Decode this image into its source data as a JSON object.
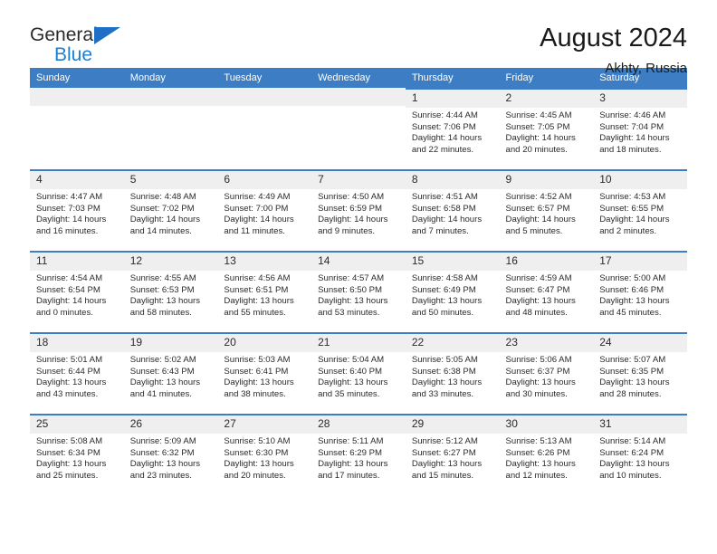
{
  "brand": {
    "name_part1": "General",
    "name_part2": "Blue",
    "accent_color": "#1f6fc4",
    "logo_icon": "triangle-icon"
  },
  "header": {
    "title": "August 2024",
    "location": "Akhty, Russia"
  },
  "calendar": {
    "header_bg": "#3c7dc4",
    "cell_accent": "#3c7dc4",
    "daynum_bg": "#efefef",
    "weekdays": [
      "Sunday",
      "Monday",
      "Tuesday",
      "Wednesday",
      "Thursday",
      "Friday",
      "Saturday"
    ],
    "weeks": [
      [
        {
          "day": "",
          "empty": true
        },
        {
          "day": "",
          "empty": true
        },
        {
          "day": "",
          "empty": true
        },
        {
          "day": "",
          "empty": true
        },
        {
          "day": "1",
          "sunrise": "Sunrise: 4:44 AM",
          "sunset": "Sunset: 7:06 PM",
          "daylight1": "Daylight: 14 hours",
          "daylight2": "and 22 minutes."
        },
        {
          "day": "2",
          "sunrise": "Sunrise: 4:45 AM",
          "sunset": "Sunset: 7:05 PM",
          "daylight1": "Daylight: 14 hours",
          "daylight2": "and 20 minutes."
        },
        {
          "day": "3",
          "sunrise": "Sunrise: 4:46 AM",
          "sunset": "Sunset: 7:04 PM",
          "daylight1": "Daylight: 14 hours",
          "daylight2": "and 18 minutes."
        }
      ],
      [
        {
          "day": "4",
          "sunrise": "Sunrise: 4:47 AM",
          "sunset": "Sunset: 7:03 PM",
          "daylight1": "Daylight: 14 hours",
          "daylight2": "and 16 minutes."
        },
        {
          "day": "5",
          "sunrise": "Sunrise: 4:48 AM",
          "sunset": "Sunset: 7:02 PM",
          "daylight1": "Daylight: 14 hours",
          "daylight2": "and 14 minutes."
        },
        {
          "day": "6",
          "sunrise": "Sunrise: 4:49 AM",
          "sunset": "Sunset: 7:00 PM",
          "daylight1": "Daylight: 14 hours",
          "daylight2": "and 11 minutes."
        },
        {
          "day": "7",
          "sunrise": "Sunrise: 4:50 AM",
          "sunset": "Sunset: 6:59 PM",
          "daylight1": "Daylight: 14 hours",
          "daylight2": "and 9 minutes."
        },
        {
          "day": "8",
          "sunrise": "Sunrise: 4:51 AM",
          "sunset": "Sunset: 6:58 PM",
          "daylight1": "Daylight: 14 hours",
          "daylight2": "and 7 minutes."
        },
        {
          "day": "9",
          "sunrise": "Sunrise: 4:52 AM",
          "sunset": "Sunset: 6:57 PM",
          "daylight1": "Daylight: 14 hours",
          "daylight2": "and 5 minutes."
        },
        {
          "day": "10",
          "sunrise": "Sunrise: 4:53 AM",
          "sunset": "Sunset: 6:55 PM",
          "daylight1": "Daylight: 14 hours",
          "daylight2": "and 2 minutes."
        }
      ],
      [
        {
          "day": "11",
          "sunrise": "Sunrise: 4:54 AM",
          "sunset": "Sunset: 6:54 PM",
          "daylight1": "Daylight: 14 hours",
          "daylight2": "and 0 minutes."
        },
        {
          "day": "12",
          "sunrise": "Sunrise: 4:55 AM",
          "sunset": "Sunset: 6:53 PM",
          "daylight1": "Daylight: 13 hours",
          "daylight2": "and 58 minutes."
        },
        {
          "day": "13",
          "sunrise": "Sunrise: 4:56 AM",
          "sunset": "Sunset: 6:51 PM",
          "daylight1": "Daylight: 13 hours",
          "daylight2": "and 55 minutes."
        },
        {
          "day": "14",
          "sunrise": "Sunrise: 4:57 AM",
          "sunset": "Sunset: 6:50 PM",
          "daylight1": "Daylight: 13 hours",
          "daylight2": "and 53 minutes."
        },
        {
          "day": "15",
          "sunrise": "Sunrise: 4:58 AM",
          "sunset": "Sunset: 6:49 PM",
          "daylight1": "Daylight: 13 hours",
          "daylight2": "and 50 minutes."
        },
        {
          "day": "16",
          "sunrise": "Sunrise: 4:59 AM",
          "sunset": "Sunset: 6:47 PM",
          "daylight1": "Daylight: 13 hours",
          "daylight2": "and 48 minutes."
        },
        {
          "day": "17",
          "sunrise": "Sunrise: 5:00 AM",
          "sunset": "Sunset: 6:46 PM",
          "daylight1": "Daylight: 13 hours",
          "daylight2": "and 45 minutes."
        }
      ],
      [
        {
          "day": "18",
          "sunrise": "Sunrise: 5:01 AM",
          "sunset": "Sunset: 6:44 PM",
          "daylight1": "Daylight: 13 hours",
          "daylight2": "and 43 minutes."
        },
        {
          "day": "19",
          "sunrise": "Sunrise: 5:02 AM",
          "sunset": "Sunset: 6:43 PM",
          "daylight1": "Daylight: 13 hours",
          "daylight2": "and 41 minutes."
        },
        {
          "day": "20",
          "sunrise": "Sunrise: 5:03 AM",
          "sunset": "Sunset: 6:41 PM",
          "daylight1": "Daylight: 13 hours",
          "daylight2": "and 38 minutes."
        },
        {
          "day": "21",
          "sunrise": "Sunrise: 5:04 AM",
          "sunset": "Sunset: 6:40 PM",
          "daylight1": "Daylight: 13 hours",
          "daylight2": "and 35 minutes."
        },
        {
          "day": "22",
          "sunrise": "Sunrise: 5:05 AM",
          "sunset": "Sunset: 6:38 PM",
          "daylight1": "Daylight: 13 hours",
          "daylight2": "and 33 minutes."
        },
        {
          "day": "23",
          "sunrise": "Sunrise: 5:06 AM",
          "sunset": "Sunset: 6:37 PM",
          "daylight1": "Daylight: 13 hours",
          "daylight2": "and 30 minutes."
        },
        {
          "day": "24",
          "sunrise": "Sunrise: 5:07 AM",
          "sunset": "Sunset: 6:35 PM",
          "daylight1": "Daylight: 13 hours",
          "daylight2": "and 28 minutes."
        }
      ],
      [
        {
          "day": "25",
          "sunrise": "Sunrise: 5:08 AM",
          "sunset": "Sunset: 6:34 PM",
          "daylight1": "Daylight: 13 hours",
          "daylight2": "and 25 minutes."
        },
        {
          "day": "26",
          "sunrise": "Sunrise: 5:09 AM",
          "sunset": "Sunset: 6:32 PM",
          "daylight1": "Daylight: 13 hours",
          "daylight2": "and 23 minutes."
        },
        {
          "day": "27",
          "sunrise": "Sunrise: 5:10 AM",
          "sunset": "Sunset: 6:30 PM",
          "daylight1": "Daylight: 13 hours",
          "daylight2": "and 20 minutes."
        },
        {
          "day": "28",
          "sunrise": "Sunrise: 5:11 AM",
          "sunset": "Sunset: 6:29 PM",
          "daylight1": "Daylight: 13 hours",
          "daylight2": "and 17 minutes."
        },
        {
          "day": "29",
          "sunrise": "Sunrise: 5:12 AM",
          "sunset": "Sunset: 6:27 PM",
          "daylight1": "Daylight: 13 hours",
          "daylight2": "and 15 minutes."
        },
        {
          "day": "30",
          "sunrise": "Sunrise: 5:13 AM",
          "sunset": "Sunset: 6:26 PM",
          "daylight1": "Daylight: 13 hours",
          "daylight2": "and 12 minutes."
        },
        {
          "day": "31",
          "sunrise": "Sunrise: 5:14 AM",
          "sunset": "Sunset: 6:24 PM",
          "daylight1": "Daylight: 13 hours",
          "daylight2": "and 10 minutes."
        }
      ]
    ]
  }
}
